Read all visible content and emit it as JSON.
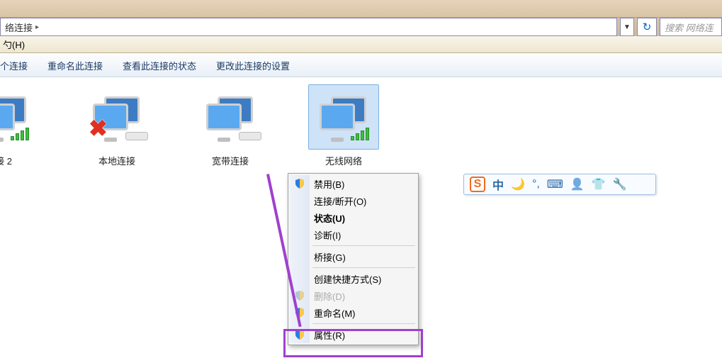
{
  "address": {
    "path": "络连接",
    "arrow": "▸"
  },
  "search": {
    "placeholder": "搜索 网络连"
  },
  "menubar": {
    "help": "勺(H)"
  },
  "toolbar": {
    "item1": "个连接",
    "item2": "重命名此连接",
    "item3": "查看此连接的状态",
    "item4": "更改此连接的设置"
  },
  "connections": [
    {
      "label": "接 2"
    },
    {
      "label": "本地连接"
    },
    {
      "label": "宽带连接"
    },
    {
      "label": "无线网络"
    }
  ],
  "ctxmenu": {
    "disable": "禁用(B)",
    "connect": "连接/断开(O)",
    "status": "状态(U)",
    "diagnose": "诊断(I)",
    "bridge": "桥接(G)",
    "shortcut": "创建快捷方式(S)",
    "delete": "删除(D)",
    "rename": "重命名(M)",
    "properties": "属性(R)"
  },
  "ime": {
    "logo": "S",
    "items": [
      "中",
      "🌙",
      "°,",
      "⌨",
      "👤",
      "👕",
      "🔧"
    ]
  }
}
